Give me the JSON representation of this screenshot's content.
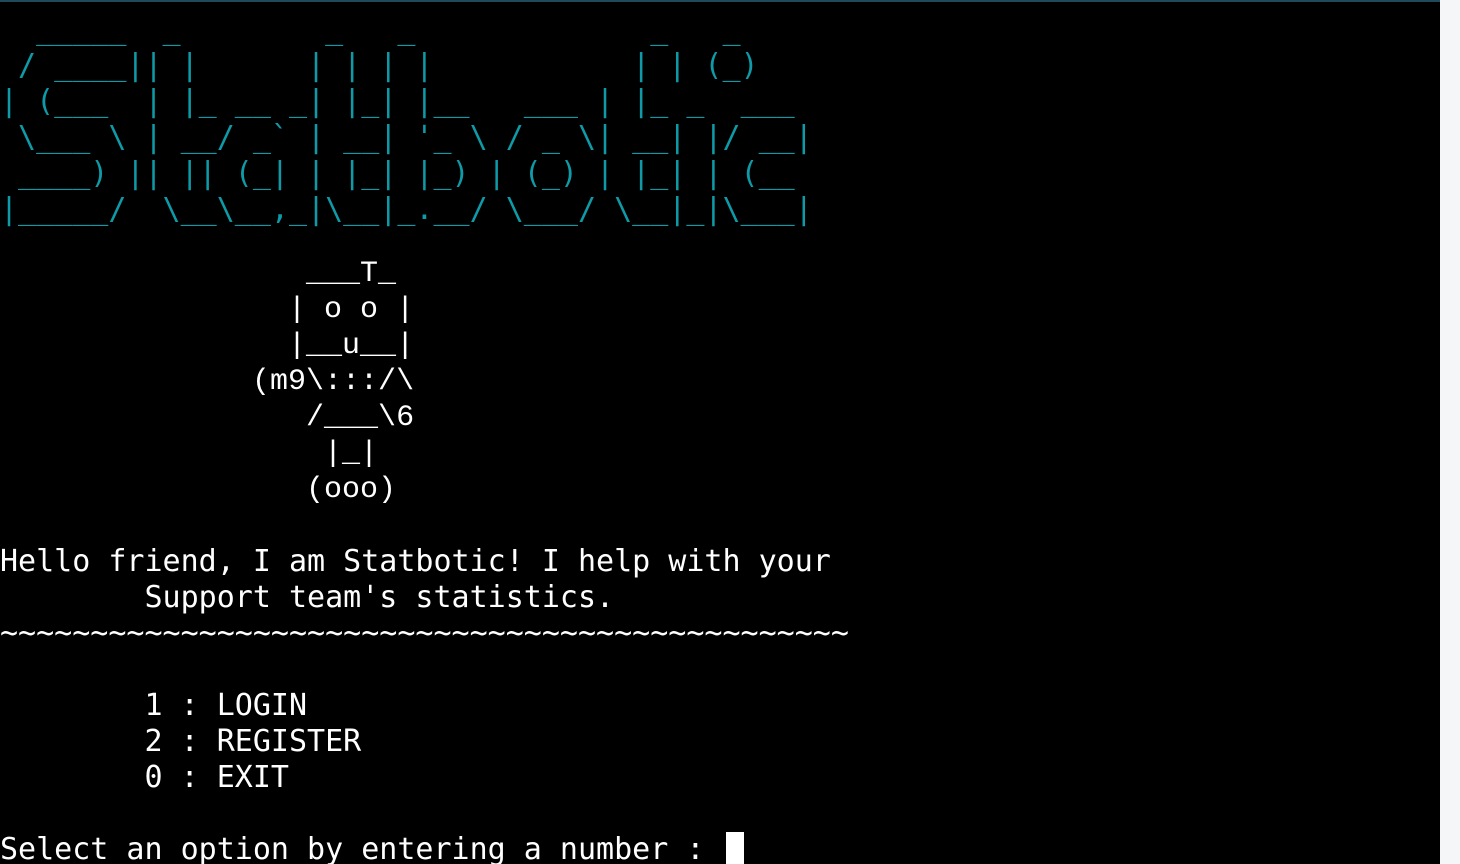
{
  "banner": {
    "art": "  _____  _        _   _             _   _      \n / ____|| |      | | | |           | | (_)     \n| (___  | |_ __ _| |_| |__   ___ | |_ _  ___ \n \\___ \\ | __/ _` | __| '_ \\ / _ \\| __| |/ __|\n ____) || || (_| | |_| |_) | (_) | |_| | (__ \n|_____/  \\__\\__,_|\\__|_.__/ \\___/ \\__|_|\\___|"
  },
  "robot": {
    "art": "                 ___T_\n                | o o |\n                |__u__|\n              (m9\\:::/\\\n                 /___\\6\n                  |_|\n                 (ooo)"
  },
  "greeting": {
    "line1": "Hello friend, I am Statbotic! I help with your",
    "line2": "        Support team's statistics."
  },
  "divider": "~~~~~~~~~~~~~~~~~~~~~~~~~~~~~~~~~~~~~~~~~~~~~~~",
  "menu": {
    "items": [
      {
        "label": "        1 : LOGIN"
      },
      {
        "label": "        2 : REGISTER"
      },
      {
        "label": "        0 : EXIT"
      }
    ]
  },
  "prompt": {
    "text": "Select an option by entering a number : ",
    "value": ""
  },
  "colors": {
    "background": "#000000",
    "text": "#ffffff",
    "banner": "#0e9aa7"
  }
}
